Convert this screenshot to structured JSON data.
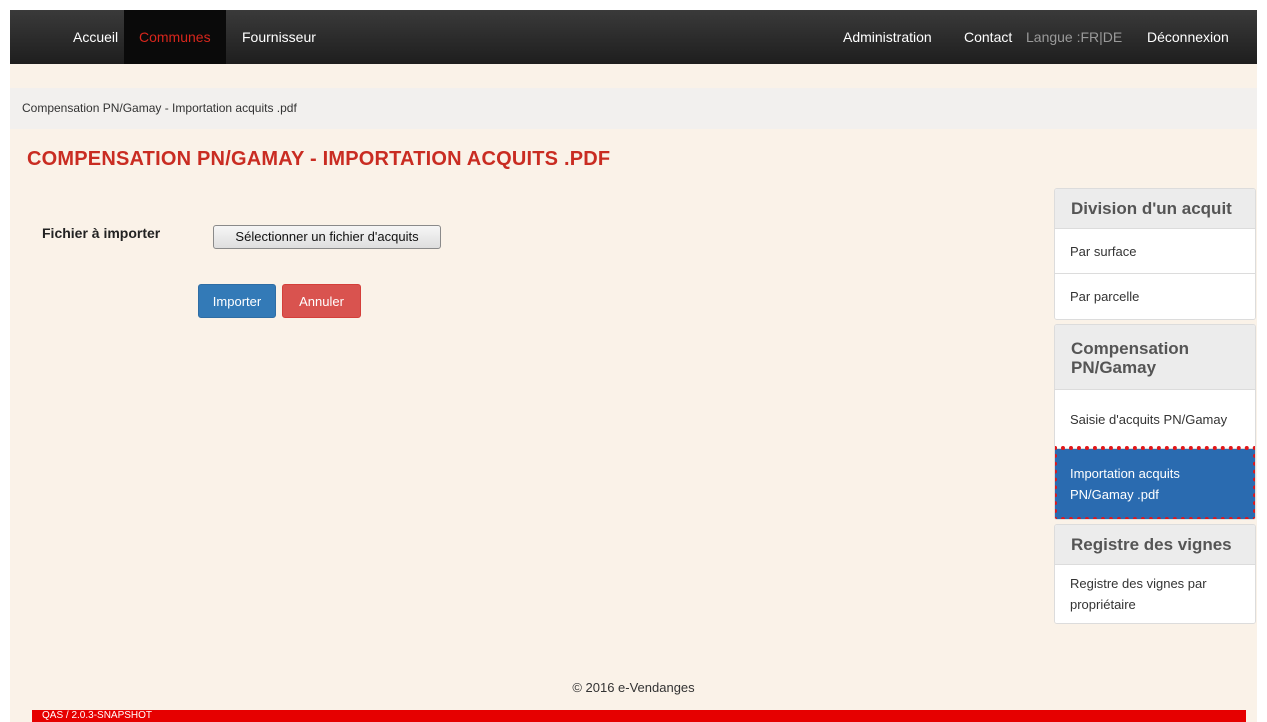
{
  "nav": {
    "accueil": "Accueil",
    "communes": "Communes",
    "fournisseur": "Fournisseur",
    "administration": "Administration",
    "contact": "Contact",
    "langue": "Langue :FR|DE",
    "deconnexion": "Déconnexion"
  },
  "breadcrumb": "Compensation PN/Gamay - Importation acquits .pdf",
  "page_title": "COMPENSATION PN/GAMAY - IMPORTATION ACQUITS .PDF",
  "form": {
    "file_label": "Fichier à importer",
    "file_button": "Sélectionner un fichier d'acquits",
    "import_button": "Importer",
    "cancel_button": "Annuler"
  },
  "sidebar": {
    "panels": [
      {
        "heading": "Division d'un acquit",
        "items": [
          "Par surface",
          "Par parcelle"
        ]
      },
      {
        "heading": "Compensation PN/Gamay",
        "items": [
          "Saisie d'acquits PN/Gamay",
          "Importation acquits PN/Gamay .pdf"
        ]
      },
      {
        "heading": "Registre des vignes",
        "items": [
          "Registre des vignes par propriétaire"
        ]
      }
    ],
    "active_item": "Importation acquits PN/Gamay .pdf"
  },
  "footer": "© 2016 e-Vendanges",
  "version": "QAS / 2.0.3-SNAPSHOT",
  "colors": {
    "accent_red": "#c92c22",
    "active_blue": "#2a6bb0",
    "version_bar": "#e60000"
  }
}
